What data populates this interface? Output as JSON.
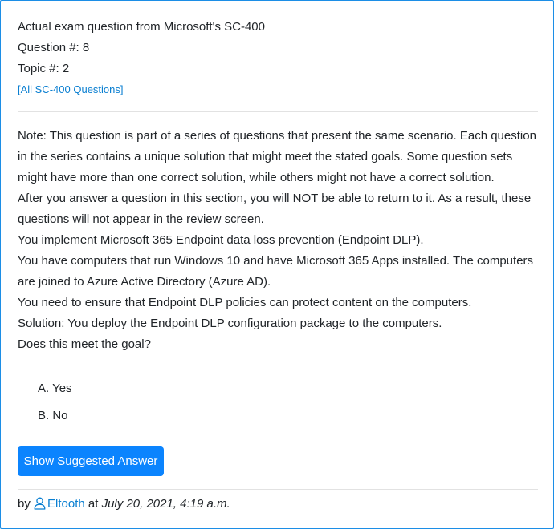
{
  "header": {
    "exam_line": "Actual exam question from Microsoft's SC-400",
    "question_number": "Question #: 8",
    "topic_number": "Topic #: 2",
    "all_questions_link": "[All SC-400 Questions]"
  },
  "question": {
    "paragraphs": [
      "Note: This question is part of a series of questions that present the same scenario. Each question in the series contains a unique solution that might meet the stated goals. Some question sets might have more than one correct solution, while others might not have a correct solution.",
      "After you answer a question in this section, you will NOT be able to return to it. As a result, these questions will not appear in the review screen.",
      "You implement Microsoft 365 Endpoint data loss prevention (Endpoint DLP).",
      "You have computers that run Windows 10 and have Microsoft 365 Apps installed. The computers are joined to Azure Active Directory (Azure AD).",
      "You need to ensure that Endpoint DLP policies can protect content on the computers.",
      "Solution: You deploy the Endpoint DLP configuration package to the computers.",
      "Does this meet the goal?"
    ]
  },
  "choices": [
    "A. Yes",
    "B. No"
  ],
  "reveal_button_label": "Show Suggested Answer",
  "footer": {
    "by": "by",
    "author": "Eltooth",
    "at": "at",
    "date": "July 20, 2021, 4:19 a.m."
  },
  "colors": {
    "link": "#0a7fd1",
    "button": "#0b84fe",
    "border": "#1c8ee6",
    "text": "#212529"
  },
  "icons": {
    "author": "user-icon"
  }
}
